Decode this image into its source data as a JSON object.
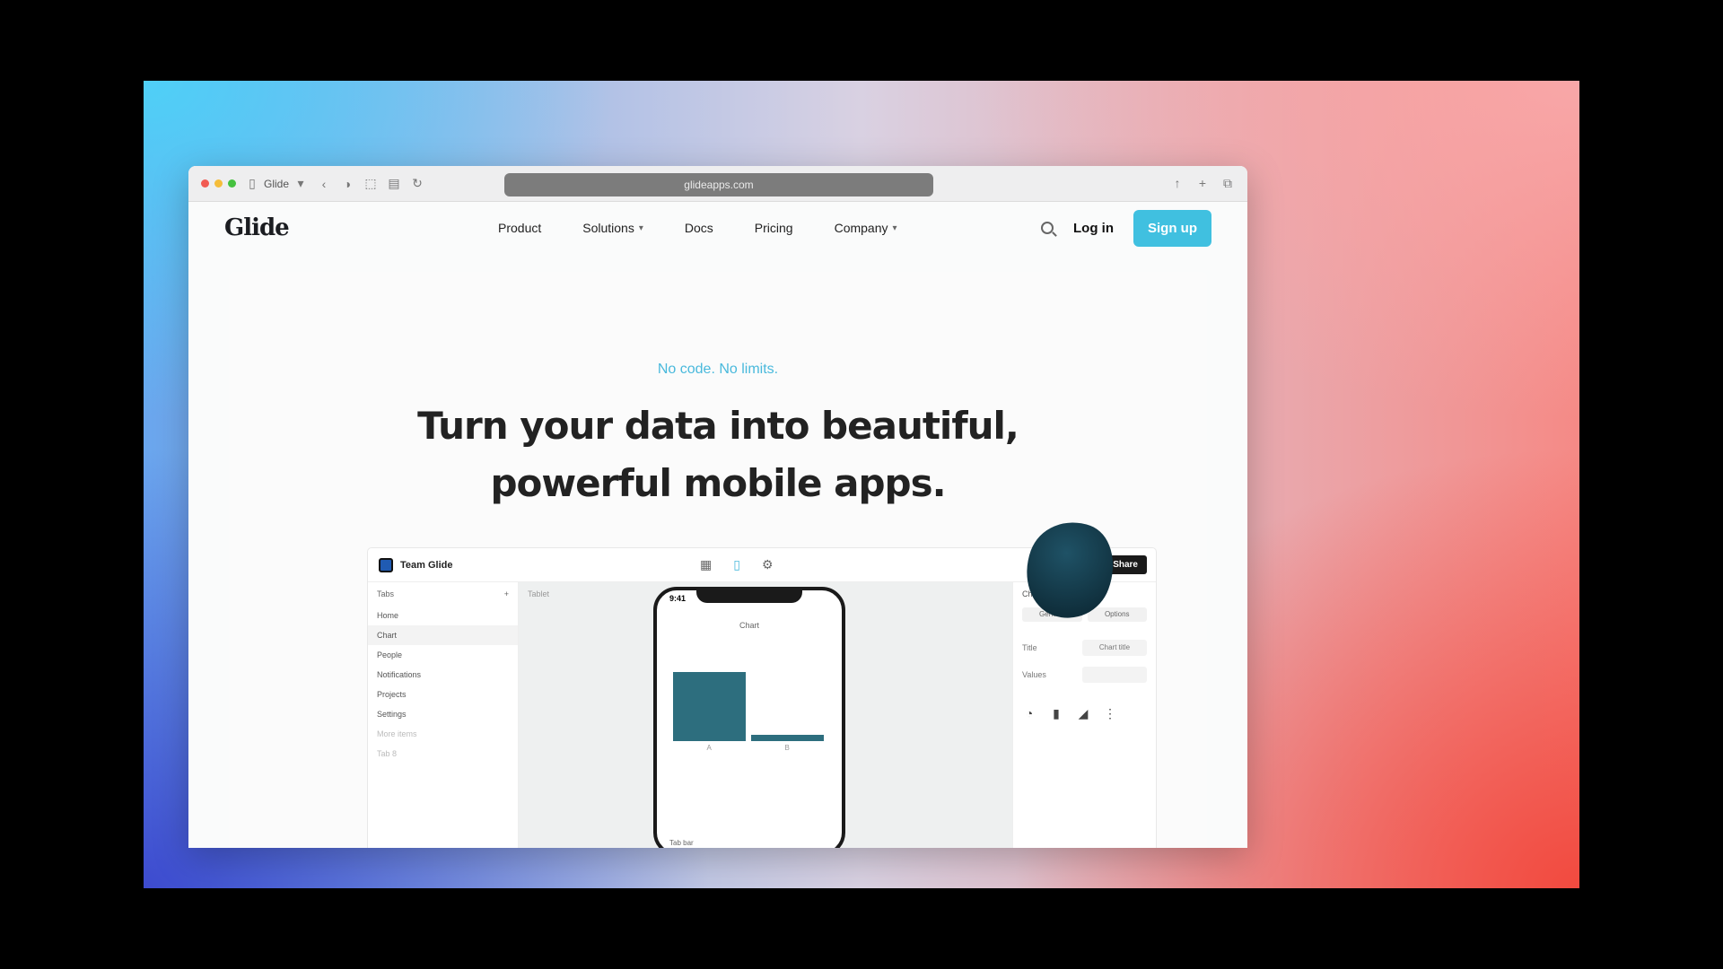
{
  "browser": {
    "tab_group": "Glide",
    "address": "glideapps.com"
  },
  "site": {
    "logo": "Glide",
    "nav": [
      "Product",
      "Solutions",
      "Docs",
      "Pricing",
      "Company"
    ],
    "login": "Log in",
    "signup": "Sign up",
    "accent": "#40c0e0"
  },
  "hero": {
    "eyebrow": "No code. No limits.",
    "headline_line1": "Turn your data into beautiful,",
    "headline_line2": "powerful mobile apps."
  },
  "editor": {
    "app_title": "Team Glide",
    "app_subtitle": "",
    "publish": "Share",
    "left_panel": {
      "header": "Tabs",
      "rows": [
        "Home",
        "Chart",
        "People",
        "Notifications",
        "Projects",
        "Settings",
        "More items",
        "Tab 8"
      ]
    },
    "canvas_label": "Tablet",
    "phone": {
      "time": "9:41",
      "title": "Chart",
      "bars": [
        {
          "label": "A",
          "value": 0.9
        },
        {
          "label": "B",
          "value": 0.08
        }
      ],
      "footer": "Tab bar"
    },
    "right_panel": {
      "title": "Chart",
      "tabs": [
        "General",
        "Options"
      ],
      "row1_label": "Title",
      "row1_value": "Chart title",
      "row2_label": "Values",
      "row2_value": ""
    }
  }
}
